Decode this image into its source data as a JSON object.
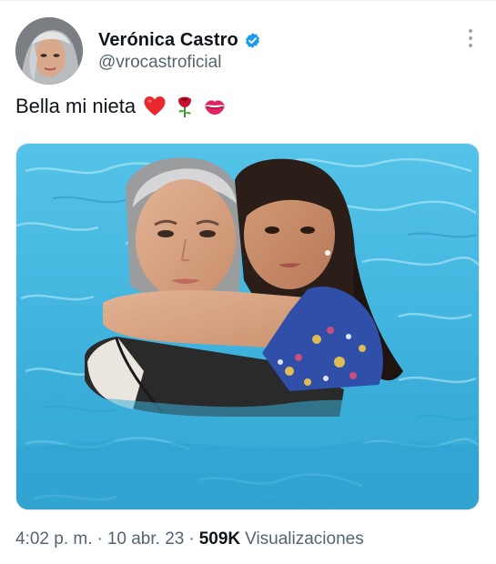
{
  "tweet": {
    "author": {
      "display_name": "Verónica Castro",
      "handle": "@vrocastroficial",
      "verified": true,
      "verified_icon": "blue-check-badge",
      "avatar_icon": "profile-photo"
    },
    "text": "Bella mi nieta",
    "emojis": [
      "red-heart",
      "rose",
      "kiss-mark"
    ],
    "media": {
      "kind": "photo",
      "subject": "pool-hug-photo"
    },
    "meta": {
      "time": "4:02 p. m.",
      "separator": "·",
      "date": "10 abr. 23",
      "views_count": "509K",
      "views_label": "Visualizaciones"
    },
    "more_icon": "vertical-ellipsis"
  },
  "colors": {
    "text_primary": "#0f1419",
    "text_secondary": "#536471",
    "verified_blue": "#1d9bf0",
    "pool_water": "#3fb3dd"
  }
}
